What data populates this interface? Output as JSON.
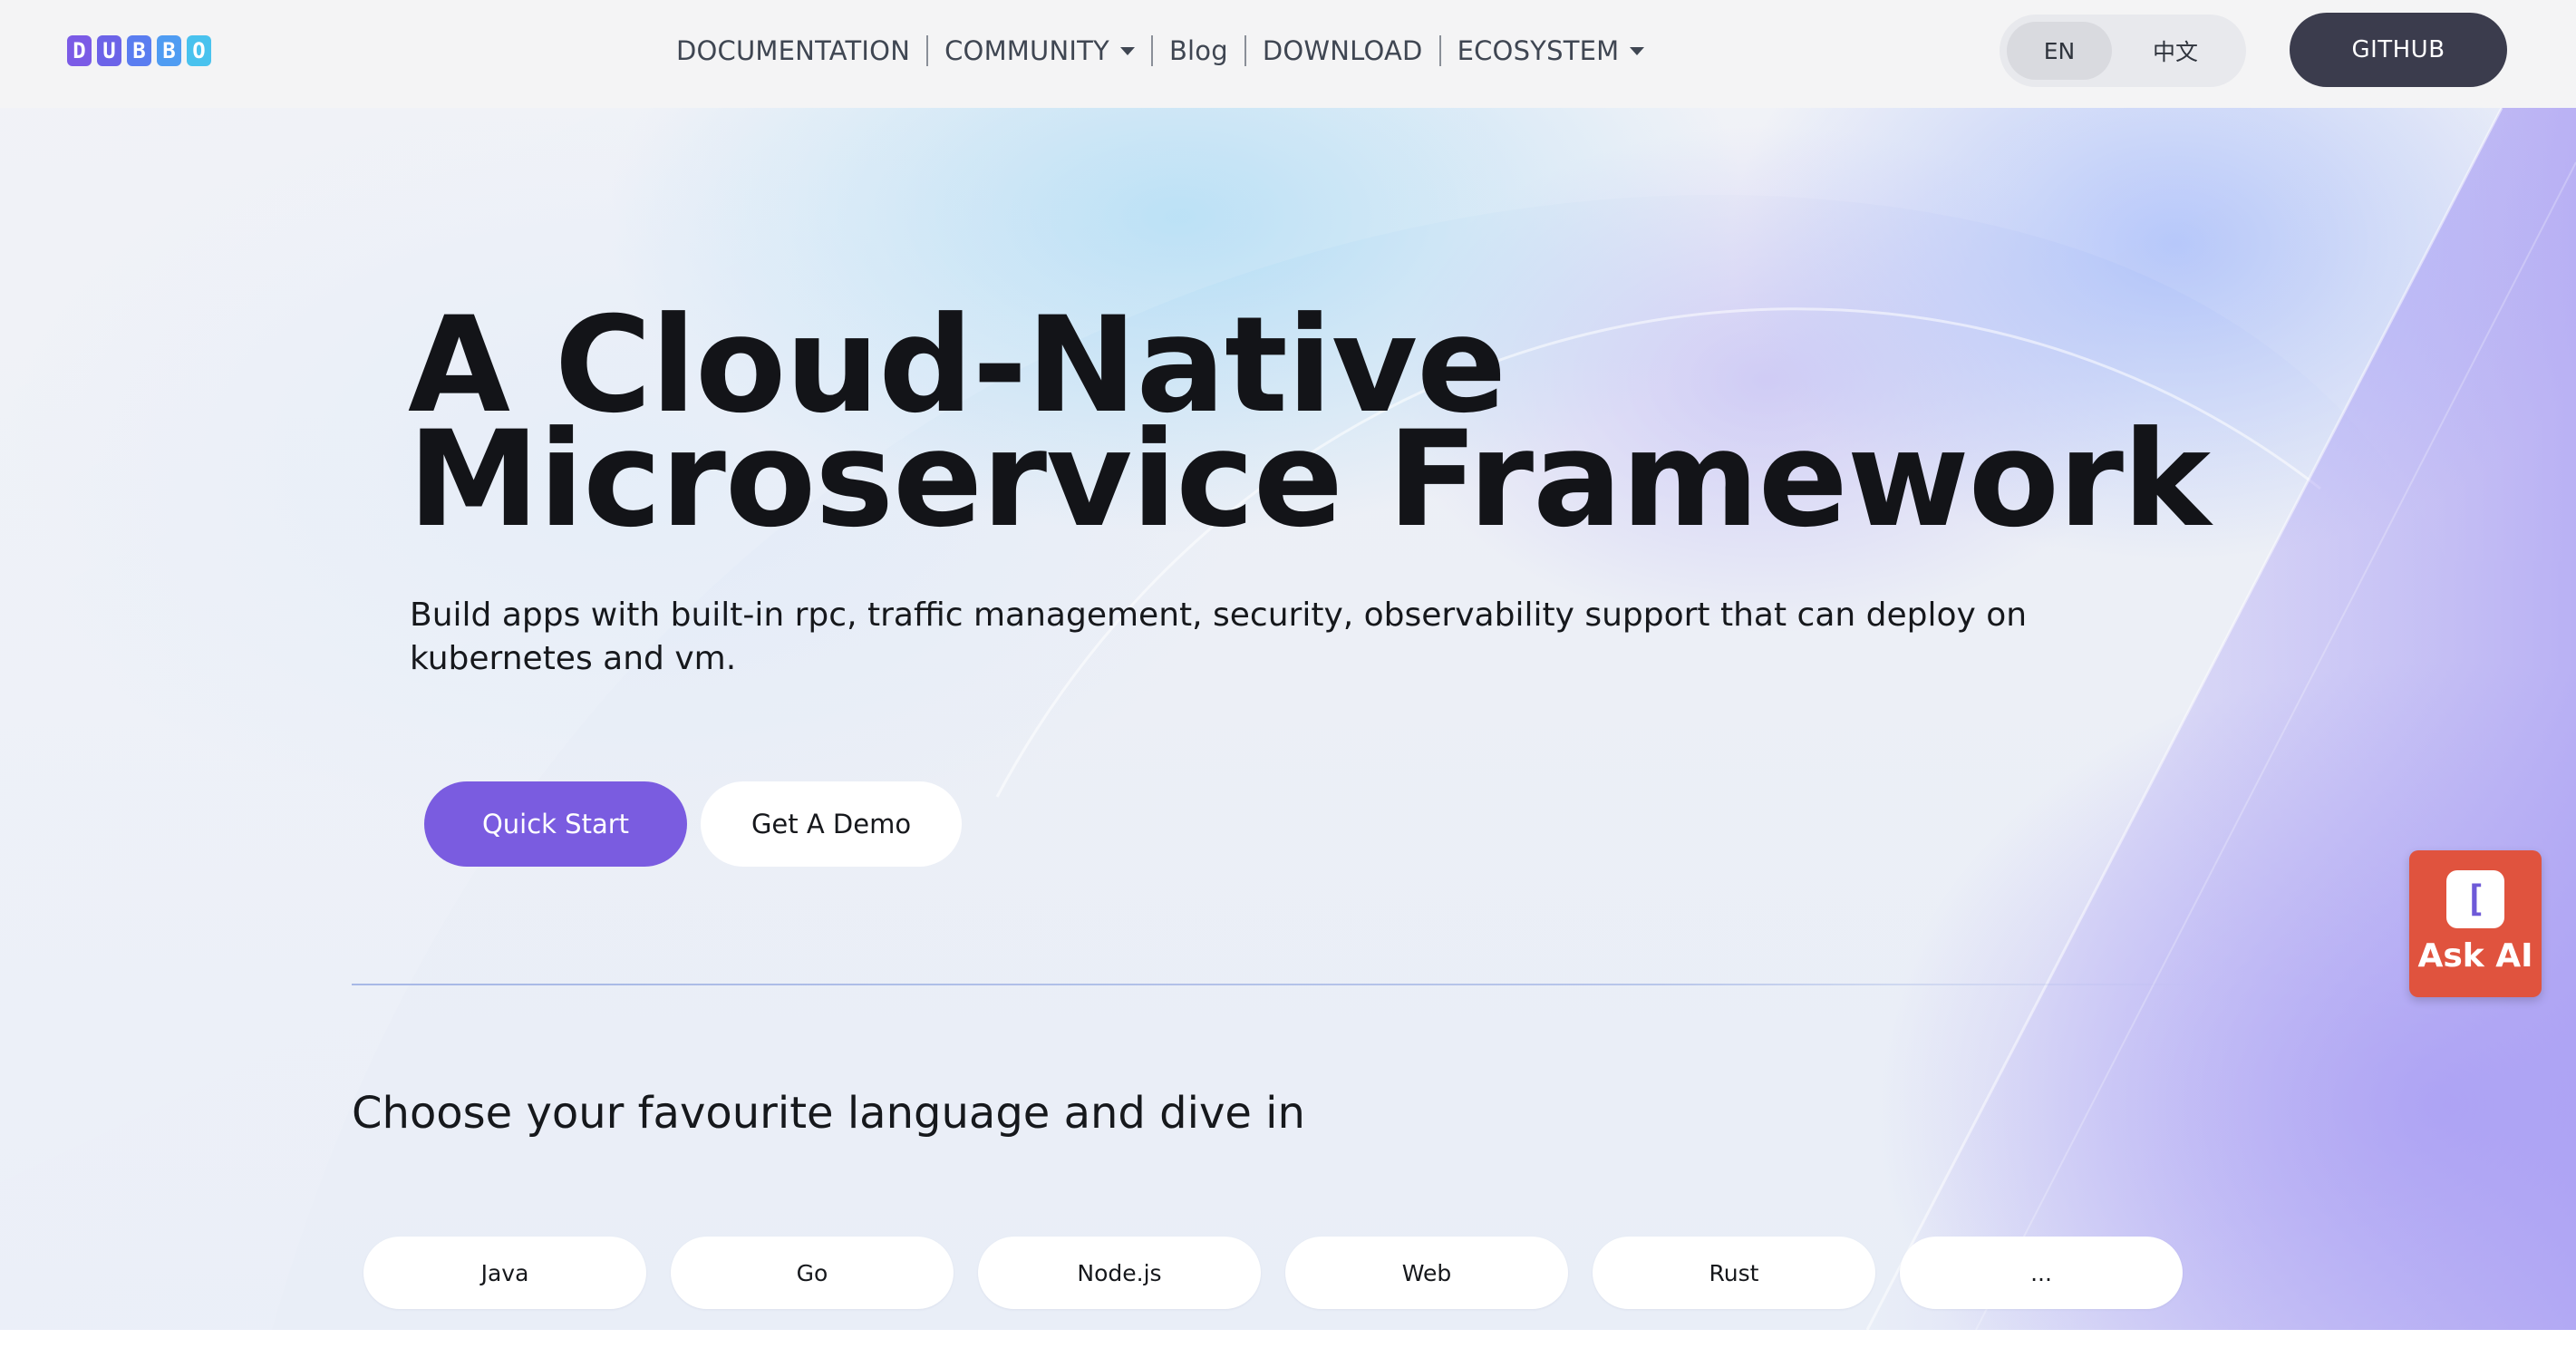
{
  "navbar": {
    "logo_letters": [
      "D",
      "U",
      "B",
      "B",
      "O"
    ],
    "logo_colors": [
      "#7b5be6",
      "#6c63e8",
      "#5a7df0",
      "#4f9cf2",
      "#49c2ee"
    ],
    "links": [
      {
        "label": "DOCUMENTATION",
        "has_dropdown": false
      },
      {
        "label": "COMMUNITY",
        "has_dropdown": true
      },
      {
        "label": "Blog",
        "has_dropdown": false
      },
      {
        "label": "DOWNLOAD",
        "has_dropdown": false
      },
      {
        "label": "ECOSYSTEM",
        "has_dropdown": true
      }
    ],
    "languages": [
      {
        "label": "EN",
        "active": true
      },
      {
        "label": "中文",
        "active": false
      }
    ],
    "github_label": "GITHUB"
  },
  "hero": {
    "title_line1": "A Cloud-Native",
    "title_line2": "Microservice Framework",
    "subtitle": "Build apps with built-in rpc, traffic management, security, observability support that can deploy on kubernetes and vm.",
    "primary_button": "Quick Start",
    "secondary_button": "Get A Demo"
  },
  "languages_section": {
    "heading": "Choose your favourite language and dive in",
    "chips": [
      "Java",
      "Go",
      "Node.js",
      "Web",
      "Rust",
      "..."
    ]
  },
  "ask_ai": {
    "icon_glyph": "[",
    "label": "Ask AI"
  },
  "colors": {
    "accent": "#7a5ce0",
    "github_bg": "#3b3c4d",
    "ask_ai_bg": "#e0533e"
  }
}
